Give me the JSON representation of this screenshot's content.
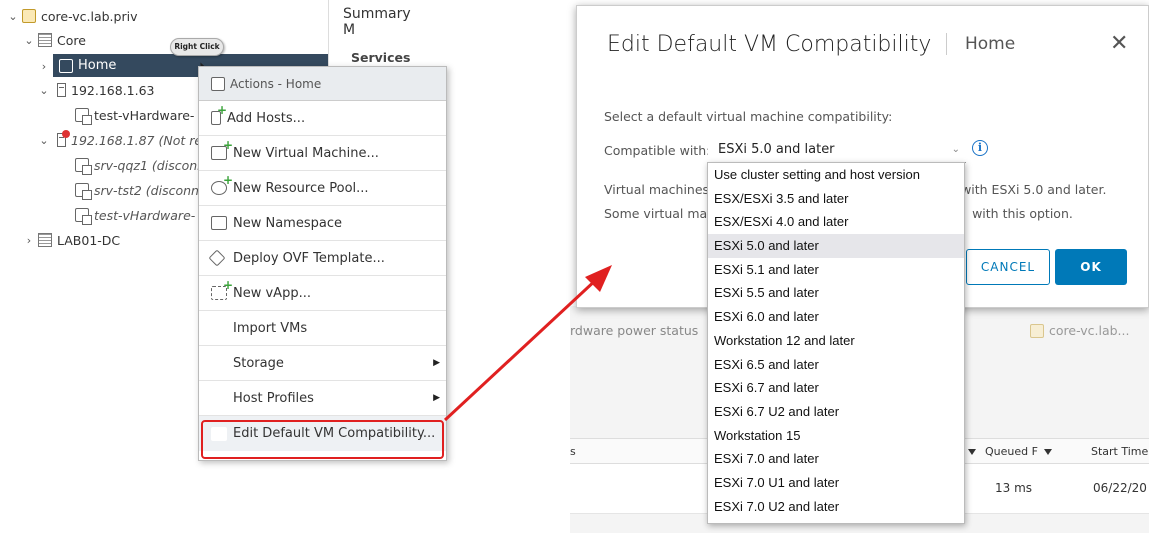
{
  "tree": {
    "root": "core-vc.lab.priv",
    "datacenter": "Core",
    "selected": "Home",
    "host1": "192.168.1.63",
    "host1_vm": "test-vHardware-",
    "host2": "192.168.1.87 (Not re",
    "host2_vm1": "srv-qqz1 (disconn",
    "host2_vm2": "srv-tst2 (disconn",
    "host2_vm3": "test-vHardware-",
    "datacenter2": "LAB01-DC"
  },
  "tooltip": "Right Click",
  "background": {
    "tab_summary": "Summary",
    "tab_m": "M",
    "services": "Services",
    "power_status": "rdware power status",
    "core_vc": "core-vc.lab...",
    "col_queued": "Queued F",
    "col_start": "Start Time",
    "col_s": "s",
    "val_ms": "13 ms",
    "val_date": "06/22/20"
  },
  "context_menu": {
    "header": "Actions - Home",
    "items": [
      {
        "label": "Add Hosts...",
        "icon": "add-hosts-icon"
      },
      {
        "label": "New Virtual Machine...",
        "icon": "new-vm-icon"
      },
      {
        "label": "New Resource Pool...",
        "icon": "resource-pool-icon"
      },
      {
        "label": "New Namespace",
        "icon": "namespace-icon"
      },
      {
        "label": "Deploy OVF Template...",
        "icon": "ovf-icon"
      },
      {
        "label": "New vApp...",
        "icon": "vapp-icon"
      },
      {
        "label": "Import VMs",
        "icon": ""
      },
      {
        "label": "Storage",
        "icon": "",
        "submenu": true
      },
      {
        "label": "Host Profiles",
        "icon": "",
        "submenu": true
      },
      {
        "label": "Edit Default VM Compatibility...",
        "icon": ""
      }
    ]
  },
  "dialog": {
    "title": "Edit Default VM Compatibility",
    "subtitle": "Home",
    "prompt": "Select a default virtual machine compatibility:",
    "compat_label": "Compatible with:",
    "selected_value": "ESXi 5.0 and later",
    "desc1_start": "Virtual machines",
    "desc1_end": "with ESXi 5.0 and later.",
    "desc2_start": "Some virtual mac",
    "desc2_end": "with this option.",
    "cancel": "CANCEL",
    "ok": "OK"
  },
  "dropdown_options": [
    "Use cluster setting and host version",
    "ESX/ESXi 3.5 and later",
    "ESX/ESXi 4.0 and later",
    "ESXi 5.0 and later",
    "ESXi 5.1 and later",
    "ESXi 5.5 and later",
    "ESXi 6.0 and later",
    "Workstation 12 and later",
    "ESXi 6.5 and later",
    "ESXi 6.7 and later",
    "ESXi 6.7 U2 and later",
    "Workstation 15",
    "ESXi 7.0 and later",
    "ESXi 7.0 U1 and later",
    "ESXi 7.0 U2 and later"
  ],
  "colors": {
    "accent": "#0079b8",
    "selected_row": "#34495e",
    "highlight": "#e02020"
  }
}
